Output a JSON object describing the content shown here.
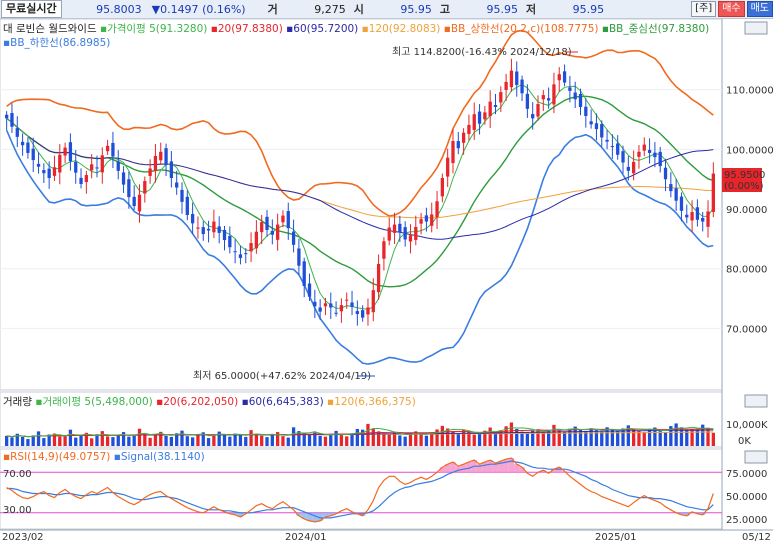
{
  "topbar": {
    "label": "무료실시간",
    "price": "95.8003",
    "change": "▼0.1497",
    "change_pct": "(0.16%)",
    "k1": "거",
    "v1": "9,275",
    "k2": "시",
    "v2": "95.95",
    "k3": "고",
    "v3": "95.95",
    "k4": "저",
    "v4": "95.95",
    "btn_main": "[주]",
    "btn_buy": "매수",
    "btn_sell": "매도"
  },
  "colors": {
    "up": "#e8252b",
    "down": "#1f4fd8",
    "ma5": "#3db54a",
    "ma20": "#e8252b",
    "ma60": "#2b2ba8",
    "ma120": "#f0a23a",
    "bb_upper": "#f06a1f",
    "bb_mid": "#2e9b3e",
    "bb_lower": "#3a7de0",
    "rsi": "#f06a1f",
    "signal": "#3a7de0",
    "rsi_fill": "#f48fc8",
    "rsi_line": "#e64ad6"
  },
  "price_panel": {
    "legend1": [
      {
        "text": "대 로빈슨 월드와이드",
        "color": "#222"
      },
      {
        "text": "가격이평 5(91.3280)",
        "color": "#3db54a"
      },
      {
        "text": "20(97.8380)",
        "color": "#e8252b"
      },
      {
        "text": "60(95.7200)",
        "color": "#2b2ba8"
      },
      {
        "text": "120(92.8083)",
        "color": "#f0a23a"
      },
      {
        "text": "BB_상한선(20.2,c)(108.7775)",
        "color": "#f06a1f"
      },
      {
        "text": "BB_중심선(97.8380)",
        "color": "#2e9b3e"
      }
    ],
    "legend2": [
      {
        "text": "BB_하한선(86.8985)",
        "color": "#3a7de0"
      }
    ],
    "y_ticks": [
      "110.0000",
      "100.0000",
      "90.0000",
      "80.0000",
      "70.0000"
    ],
    "y_tick_values": [
      110,
      100,
      90,
      80,
      70
    ],
    "current_price": "95.9500",
    "current_pct": "(0.00%)",
    "high_annotation": "최고 114.8200(-16.43% 2024/12/18)",
    "low_annotation": "최저 65.0000(+47.62% 2024/04/19)",
    "high_value": 114.82,
    "low_value": 65.0
  },
  "volume_panel": {
    "legend": [
      {
        "text": "거래량",
        "color": "#222"
      },
      {
        "text": "거래이평 5(5,498,000)",
        "color": "#3db54a"
      },
      {
        "text": "20(6,202,050)",
        "color": "#e8252b"
      },
      {
        "text": "60(6,645,383)",
        "color": "#2b2ba8"
      },
      {
        "text": "120(6,366,375)",
        "color": "#f0a23a"
      }
    ],
    "y_ticks": [
      "10,000K",
      "0K"
    ]
  },
  "rsi_panel": {
    "legend": [
      {
        "text": "RSI(14,9)(49.0757)",
        "color": "#f06a1f"
      },
      {
        "text": "Signal(38.1140)",
        "color": "#3a7de0"
      }
    ],
    "level_high": "70.00",
    "level_low": "30.00",
    "y_ticks": [
      "75.0000",
      "50.0000",
      "25.0000"
    ]
  },
  "x_axis": {
    "labels": [
      "2023/02",
      "2024/01",
      "2025/01",
      "05/12"
    ]
  },
  "chart_data": {
    "type": "candlestick",
    "title": "대 로빈슨 월드와이드",
    "ylim": [
      60,
      118
    ],
    "close": [
      105.2,
      103.8,
      102.1,
      100.7,
      99.4,
      98.2,
      97.1,
      96.0,
      95.2,
      97.0,
      99.1,
      100.3,
      98.0,
      96.1,
      94.2,
      95.7,
      97.5,
      96.8,
      99.0,
      100.6,
      98.8,
      96.4,
      94.1,
      92.0,
      90.5,
      92.4,
      94.7,
      96.8,
      98.9,
      99.6,
      97.4,
      95.2,
      93.6,
      91.2,
      89.0,
      87.6,
      86.9,
      85.8,
      86.4,
      87.9,
      86.0,
      84.8,
      83.6,
      82.9,
      81.8,
      82.6,
      84.3,
      86.2,
      87.8,
      86.5,
      85.7,
      87.4,
      88.9,
      86.8,
      84.0,
      80.5,
      77.1,
      75.3,
      73.7,
      72.8,
      74.2,
      73.5,
      72.6,
      73.9,
      74.8,
      73.6,
      72.4,
      71.8,
      73.5,
      76.4,
      80.8,
      84.6,
      86.9,
      87.4,
      86.1,
      84.9,
      85.6,
      87.0,
      88.3,
      87.9,
      89.1,
      91.3,
      95.2,
      98.6,
      101.4,
      100.2,
      102.8,
      104.1,
      105.9,
      104.3,
      106.2,
      108.0,
      107.1,
      109.6,
      111.3,
      113.2,
      110.8,
      109.4,
      106.8,
      105.2,
      107.6,
      109.1,
      108.2,
      110.9,
      112.6,
      111.2,
      109.8,
      108.4,
      107.1,
      105.6,
      104.2,
      103.4,
      102.0,
      101.3,
      100.4,
      99.1,
      97.8,
      96.4,
      97.9,
      99.6,
      100.8,
      99.4,
      98.7,
      97.2,
      95.0,
      93.0,
      91.4,
      89.7,
      88.6,
      89.5,
      88.2,
      87.9,
      89.6,
      95.95
    ],
    "vol_panel_ylim": [
      0,
      15000
    ],
    "volume": [
      4200,
      3600,
      5100,
      3800,
      2900,
      4400,
      6100,
      3300,
      4800,
      5200,
      3900,
      4100,
      6800,
      3500,
      4600,
      5500,
      3200,
      4900,
      6200,
      4000,
      3700,
      4400,
      5800,
      3900,
      4300,
      7200,
      5100,
      3400,
      4700,
      5900,
      4200,
      3800,
      5300,
      6400,
      4100,
      3600,
      4800,
      5700,
      3300,
      4500,
      6000,
      4700,
      3900,
      5200,
      4400,
      3800,
      6600,
      5100,
      4300,
      3700,
      4900,
      5800,
      4100,
      3500,
      7800,
      6200,
      5400,
      4800,
      5600,
      4200,
      3900,
      5100,
      6300,
      4600,
      4000,
      5300,
      7100,
      6800,
      9200,
      7400,
      6100,
      5200,
      4700,
      5800,
      4400,
      3900,
      5200,
      6100,
      4800,
      4300,
      5700,
      6900,
      8400,
      7300,
      6200,
      5400,
      6800,
      5900,
      4700,
      5300,
      6400,
      7700,
      5800,
      6600,
      8200,
      9800,
      7100,
      6000,
      5500,
      6300,
      7000,
      5900,
      6700,
      8800,
      6400,
      5800,
      7200,
      8100,
      6900,
      6300,
      7400,
      6600,
      5900,
      7800,
      6800,
      6100,
      7300,
      8600,
      7000,
      6400,
      5800,
      6900,
      7700,
      6200,
      5600,
      8300,
      9400,
      7800,
      6500,
      7100,
      6800,
      8900,
      7600,
      5498
    ],
    "rsi": [
      55,
      52,
      48,
      45,
      44,
      46,
      49,
      51,
      47,
      45,
      50,
      53,
      49,
      46,
      44,
      48,
      51,
      49,
      52,
      55,
      50,
      46,
      43,
      40,
      38,
      41,
      45,
      48,
      50,
      51,
      47,
      44,
      41,
      38,
      35,
      33,
      31,
      30,
      33,
      36,
      33,
      31,
      29,
      28,
      26,
      29,
      33,
      37,
      39,
      36,
      34,
      38,
      41,
      37,
      33,
      27,
      24,
      22,
      21,
      22,
      26,
      27,
      29,
      32,
      34,
      31,
      29,
      27,
      33,
      42,
      55,
      62,
      66,
      66,
      61,
      58,
      60,
      63,
      65,
      63,
      66,
      70,
      75,
      78,
      80,
      76,
      78,
      80,
      82,
      78,
      80,
      82,
      79,
      81,
      83,
      84,
      78,
      75,
      69,
      66,
      70,
      72,
      69,
      73,
      75,
      71,
      66,
      62,
      58,
      54,
      51,
      49,
      46,
      44,
      42,
      40,
      38,
      36,
      40,
      44,
      47,
      44,
      42,
      40,
      36,
      33,
      30,
      28,
      27,
      31,
      29,
      28,
      34,
      49
    ],
    "signal": [
      54,
      54,
      53,
      51,
      50,
      49,
      49,
      49,
      49,
      48,
      48,
      49,
      49,
      48,
      47,
      47,
      48,
      48,
      49,
      50,
      50,
      49,
      48,
      46,
      44,
      43,
      43,
      44,
      45,
      46,
      46,
      45,
      44,
      42,
      40,
      38,
      36,
      34,
      33,
      33,
      33,
      32,
      32,
      31,
      30,
      30,
      30,
      31,
      32,
      33,
      33,
      34,
      35,
      35,
      35,
      33,
      31,
      29,
      27,
      25,
      25,
      25,
      26,
      27,
      28,
      29,
      29,
      29,
      30,
      32,
      36,
      41,
      46,
      50,
      53,
      55,
      56,
      58,
      59,
      60,
      61,
      63,
      65,
      68,
      70,
      72,
      73,
      74,
      76,
      76,
      77,
      78,
      78,
      79,
      80,
      81,
      80,
      79,
      77,
      75,
      74,
      74,
      73,
      73,
      73,
      73,
      72,
      70,
      68,
      66,
      63,
      61,
      58,
      56,
      53,
      51,
      49,
      47,
      46,
      45,
      45,
      45,
      44,
      44,
      43,
      42,
      40,
      38,
      36,
      35,
      34,
      33,
      33,
      38.1
    ]
  }
}
